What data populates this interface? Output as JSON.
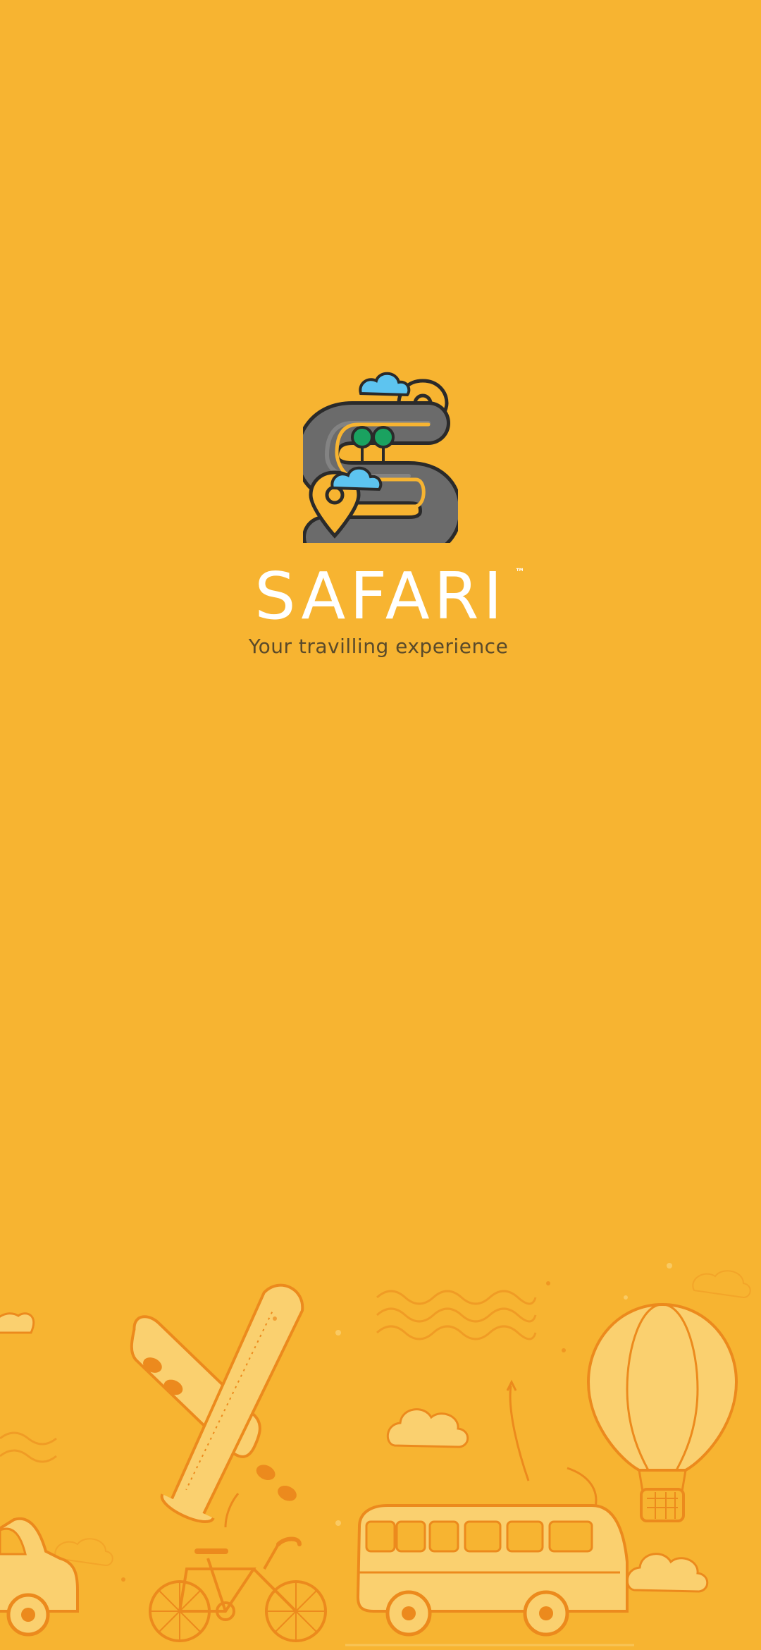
{
  "screen": "splash",
  "brand": {
    "name": "SAFARI",
    "trademark": "™",
    "tagline": "Your travilling experience"
  },
  "logo": {
    "icon": "winding-road-s-logo-icon"
  },
  "illustration": {
    "items": [
      "airplane-icon",
      "hot-air-balloon-icon",
      "bus-icon",
      "bicycle-icon",
      "car-icon",
      "cloud-icon",
      "waves-icon"
    ]
  },
  "colors": {
    "background": "#F7B431",
    "text_primary": "#FFFFFF",
    "tagline": "#5A4A2A",
    "road": "#5E5E5E",
    "pin": "#F7B431",
    "cloud": "#5DC4F0",
    "tree": "#1AA260",
    "illustration_fill": "#FAD06F",
    "illustration_stroke": "#EC8A1D"
  }
}
